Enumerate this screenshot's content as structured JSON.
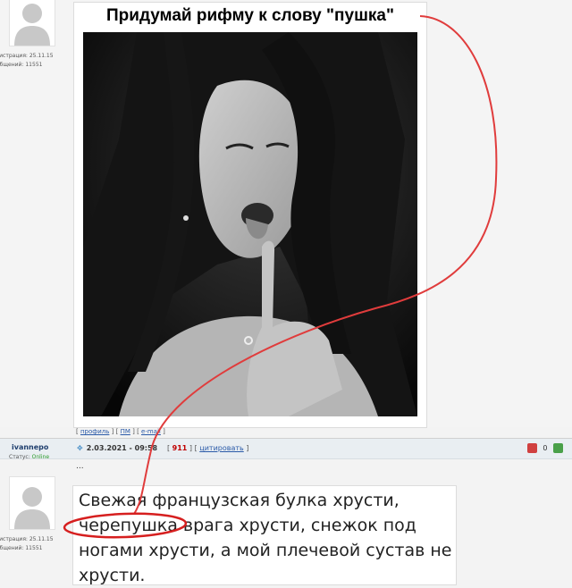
{
  "post1": {
    "user_meta": {
      "registration": "гистрация: 25.11.15",
      "messages": "общений: 11551"
    },
    "title": "Придумай рифму к слову \"пушка\"",
    "links": {
      "open": "[",
      "profile": "профиль",
      "sep1": "] [",
      "pm": "ПМ",
      "sep2": "] [",
      "email": "e-mail",
      "close": "]"
    }
  },
  "post2": {
    "username": "ivannepo",
    "status_label": "Статус:",
    "status_value": "Online",
    "date": "2.03.2021 - 09:58",
    "post_number_open": "[",
    "post_number": "911",
    "post_number_mid": "] [",
    "quote": "цитировать",
    "post_number_close": "]",
    "ellipsis": "...",
    "user_meta": {
      "registration": "гистрация: 25.11.15",
      "messages": "общений: 11551"
    },
    "rating": "0",
    "text": "Свежая французская булка хрусти, черепушка врага хрусти, снежок под ногами хрусти, а мой плечевой сустав не хрусти."
  },
  "colors": {
    "annotation_red": "#e03c3c",
    "username_blue": "#1f3f6e",
    "link_blue": "#2a5aa8",
    "online_green": "#2a9a2a",
    "post_number_red": "#c00000"
  },
  "icons": [
    "avatar-silhouette",
    "post-marker-icon",
    "report-icon",
    "plus-icon"
  ]
}
